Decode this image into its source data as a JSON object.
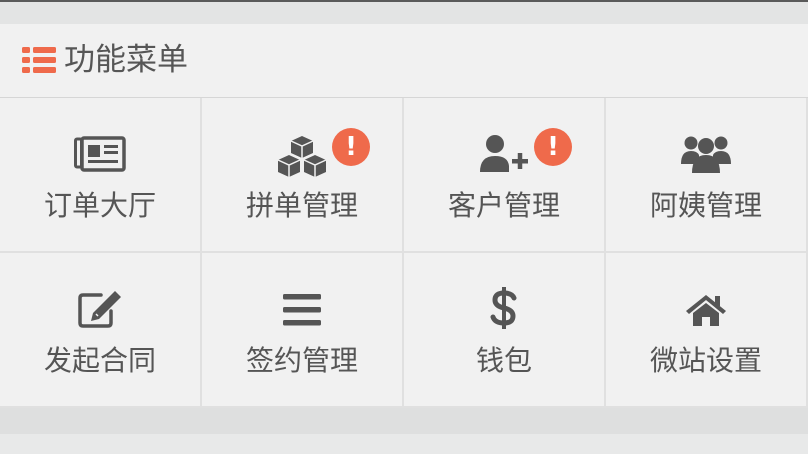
{
  "header": {
    "title": "功能菜单",
    "icon": "list-icon"
  },
  "colors": {
    "accent": "#ef6a4b",
    "icon": "#555555",
    "text": "#555555"
  },
  "menu": [
    {
      "label": "订单大厅",
      "icon": "newspaper-icon",
      "badge": ""
    },
    {
      "label": "拼单管理",
      "icon": "cubes-icon",
      "badge": "!"
    },
    {
      "label": "客户管理",
      "icon": "user-plus-icon",
      "badge": "!"
    },
    {
      "label": "阿姨管理",
      "icon": "users-icon",
      "badge": ""
    },
    {
      "label": "发起合同",
      "icon": "edit-icon",
      "badge": ""
    },
    {
      "label": "签约管理",
      "icon": "bars-icon",
      "badge": ""
    },
    {
      "label": "钱包",
      "icon": "dollar-icon",
      "badge": ""
    },
    {
      "label": "微站设置",
      "icon": "home-icon",
      "badge": ""
    }
  ]
}
